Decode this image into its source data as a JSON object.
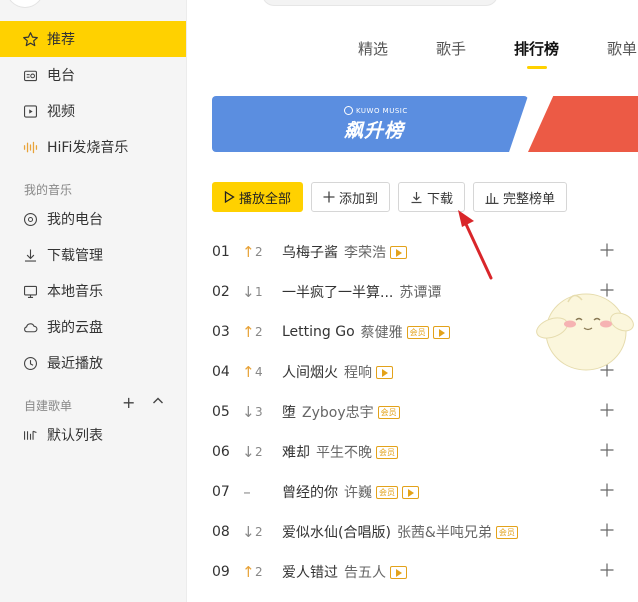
{
  "sidebar": {
    "items": [
      {
        "label": "推荐",
        "icon": "star-icon",
        "active": true
      },
      {
        "label": "电台",
        "icon": "radio-icon"
      },
      {
        "label": "视频",
        "icon": "video-icon"
      },
      {
        "label": "HiFi发烧音乐",
        "icon": "waveform-icon"
      }
    ],
    "my_music_label": "我的音乐",
    "my_music": [
      {
        "label": "我的电台",
        "icon": "radio-circle-icon"
      },
      {
        "label": "下载管理",
        "icon": "download-icon"
      },
      {
        "label": "本地音乐",
        "icon": "monitor-icon"
      },
      {
        "label": "我的云盘",
        "icon": "cloud-icon"
      },
      {
        "label": "最近播放",
        "icon": "clock-icon"
      }
    ],
    "playlist_label": "自建歌单",
    "playlists": [
      {
        "label": "默认列表",
        "icon": "playlist-icon"
      }
    ]
  },
  "tabs": [
    {
      "label": "精选",
      "active": false
    },
    {
      "label": "歌手",
      "active": false
    },
    {
      "label": "排行榜",
      "active": true
    },
    {
      "label": "歌单",
      "active": false
    }
  ],
  "banner": {
    "brand": "KUWO MUSIC",
    "title": "飙升榜",
    "colors": {
      "blue": "#5b8ee0",
      "red": "#ec5a45"
    }
  },
  "actions": {
    "play_all": "播放全部",
    "add_to": "添加到",
    "download": "下载",
    "full_list": "完整榜单"
  },
  "songs": [
    {
      "rank": "01",
      "trend": "up",
      "change": "2",
      "title": "乌梅子酱",
      "artist": "李荣浩",
      "mv": true,
      "vip": false
    },
    {
      "rank": "02",
      "trend": "down",
      "change": "1",
      "title": "一半疯了一半算...",
      "artist": "苏谭谭",
      "mv": false,
      "vip": false
    },
    {
      "rank": "03",
      "trend": "up",
      "change": "2",
      "title": "Letting Go",
      "artist": "蔡健雅",
      "mv": true,
      "vip": true
    },
    {
      "rank": "04",
      "trend": "up",
      "change": "4",
      "title": "人间烟火",
      "artist": "程响",
      "mv": true,
      "vip": false
    },
    {
      "rank": "05",
      "trend": "down",
      "change": "3",
      "title": "堕",
      "artist": "Zyboy忠宇",
      "mv": false,
      "vip": true
    },
    {
      "rank": "06",
      "trend": "down",
      "change": "2",
      "title": "难却",
      "artist": "平生不晚",
      "mv": false,
      "vip": true
    },
    {
      "rank": "07",
      "trend": "same",
      "change": "",
      "title": "曾经的你",
      "artist": "许巍",
      "mv": true,
      "vip": true
    },
    {
      "rank": "08",
      "trend": "down",
      "change": "2",
      "title": "爱似水仙(合唱版)",
      "artist": "张茜&半吨兄弟",
      "mv": false,
      "vip": true
    },
    {
      "rank": "09",
      "trend": "up",
      "change": "2",
      "title": "爱人错过",
      "artist": "告五人",
      "mv": true,
      "vip": false
    }
  ],
  "vip_tag": "会员",
  "accent_color": "#ffd100"
}
